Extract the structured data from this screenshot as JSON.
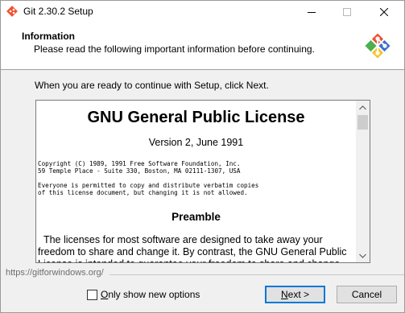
{
  "window": {
    "title": "Git 2.30.2 Setup"
  },
  "header": {
    "title": "Information",
    "subtitle": "Please read the following important information before continuing."
  },
  "intro": "When you are ready to continue with Setup, click Next.",
  "license": {
    "title": "GNU General Public License",
    "version": "Version 2, June 1991",
    "copyright_lines": [
      "Copyright (C) 1989, 1991 Free Software Foundation, Inc.",
      "59 Temple Place - Suite 330, Boston, MA  02111-1307, USA"
    ],
    "permission_lines": [
      "Everyone is permitted to copy and distribute verbatim copies",
      "of this license document, but changing it is not allowed."
    ],
    "preamble_heading": "Preamble",
    "preamble_text": "  The licenses for most software are designed to take away your freedom to share and change it. By contrast, the GNU General Public License is intended to guarantee your freedom to share and change free software."
  },
  "footer": {
    "link": "https://gitforwindows.org/",
    "checkbox_label_hotkey": "O",
    "checkbox_label_rest": "nly show new options",
    "checkbox_checked": false,
    "next_hotkey": "N",
    "next_rest": "ext >",
    "cancel_label": "Cancel"
  },
  "icons": {
    "app": "git-logo-icon",
    "minimize": "minimize-icon",
    "maximize": "maximize-icon",
    "close": "close-icon"
  },
  "colors": {
    "git_red": "#f05033",
    "git_blue": "#3b6fd1",
    "git_green": "#4cb050",
    "git_yellow": "#f4c430",
    "focus_blue": "#0078d7"
  }
}
